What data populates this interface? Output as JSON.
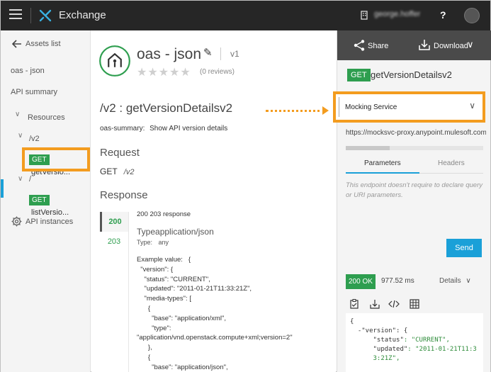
{
  "topbar": {
    "brand": "Exchange",
    "user": "george.hoffer",
    "help": "?"
  },
  "left_nav": {
    "back": "Assets list",
    "asset": "oas - json",
    "summary": "API summary",
    "resources": "Resources",
    "v2": "/v2",
    "get_badge": "GET",
    "get_op": "getVersio...",
    "root": "/",
    "list_badge": "GET",
    "list_op": "listVersio...",
    "instances": "API instances"
  },
  "main": {
    "title": "oas - json",
    "version": "v1",
    "rating_stars": 0,
    "reviews": "(0 reviews)",
    "endpoint_title": "/v2 : getVersionDetailsv2",
    "summary_label": "oas-summary:",
    "summary_text": "Show API version details",
    "request_heading": "Request",
    "request_method": "GET",
    "request_path": "/v2",
    "response_heading": "Response",
    "codes": [
      "200",
      "203"
    ],
    "response_desc": "200 203 response",
    "type_heading": "Typeapplication/json",
    "type_label": "Type:",
    "type_value": "any",
    "example": "Example value:   {\n  \"version\": {\n    \"status\": \"CURRENT\",\n    \"updated\": \"2011-01-21T11:33:21Z\",\n    \"media-types\": [\n      {\n        \"base\": \"application/xml\",\n        \"type\":\n\"application/vnd.openstack.compute+xml;version=2\"\n      },\n      {\n        \"base\": \"application/json\","
  },
  "right": {
    "share": "Share",
    "download": "Download",
    "op_badge": "GET",
    "op_name": "getVersionDetailsv2",
    "mock_service": "Mocking Service",
    "url": "https://mocksvc-proxy.anypoint.mulesoft.com",
    "tab_params": "Parameters",
    "tab_headers": "Headers",
    "no_params": "This endpoint doesn't require to declare query or URI parameters.",
    "send": "Send",
    "status": "200 OK",
    "latency": "977.52 ms",
    "details": "Details",
    "scroll_position": 0.32
  },
  "response_code": {
    "l1": "{",
    "l2a": "  -\"version\": {",
    "l3k": "      \"status\"",
    "l3v": ": \"CURRENT\",",
    "l4k": "      \"updated\"",
    "l4v": ": \"2011-01-21T11:3",
    "l5": "      3:21Z\","
  },
  "colors": {
    "accent_green": "#2e9e4f",
    "accent_blue": "#1aa0d8",
    "highlight_orange": "#f39c1f",
    "topbar": "#262626"
  }
}
